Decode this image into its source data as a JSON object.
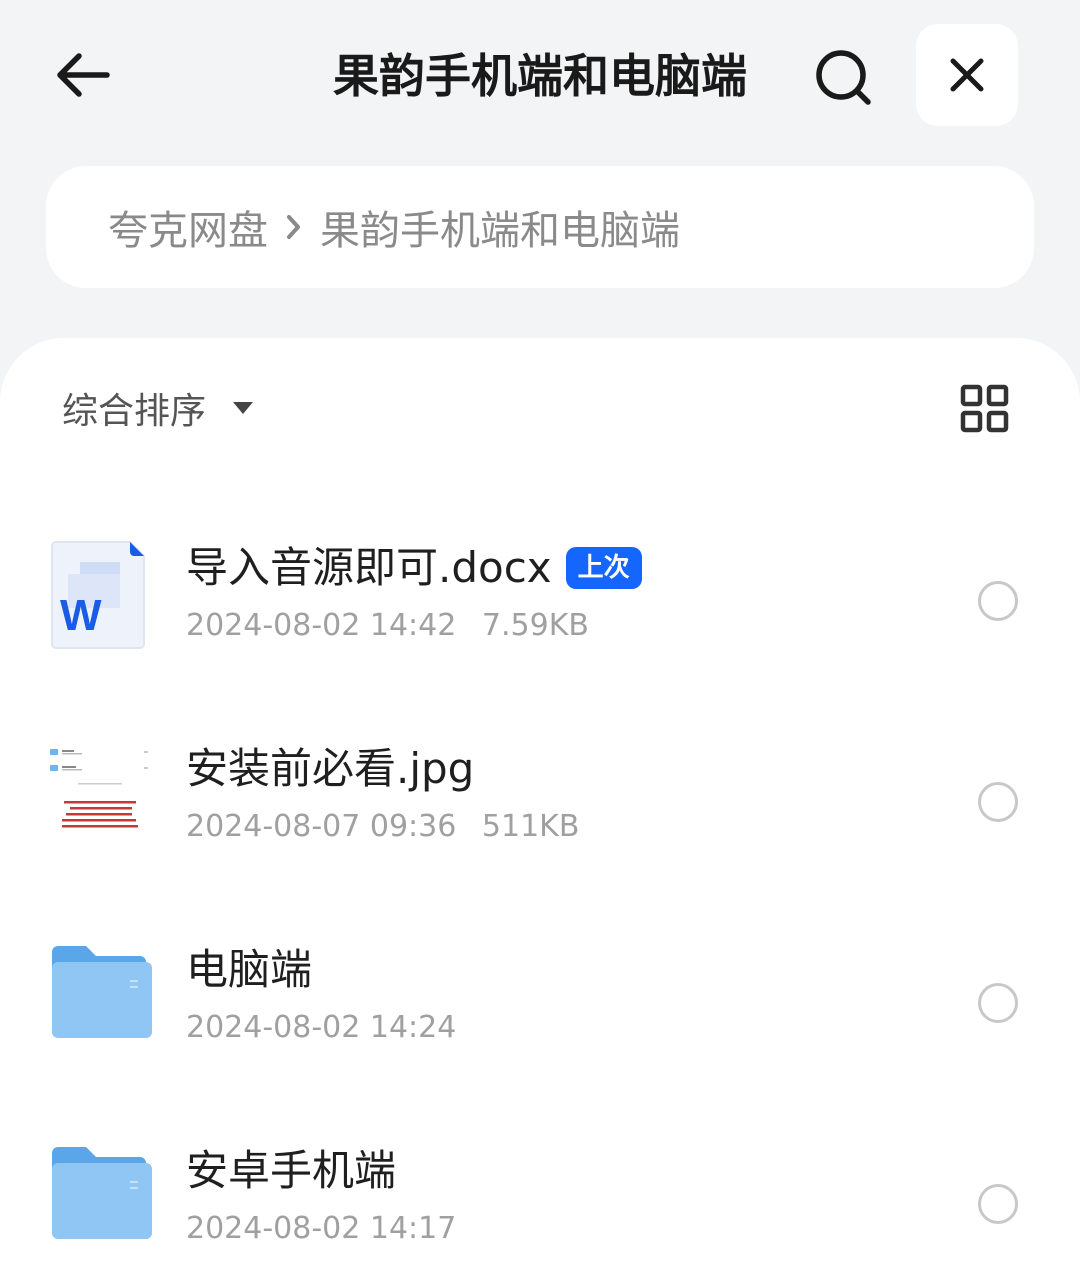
{
  "header": {
    "title": "果韵手机端和电脑端"
  },
  "breadcrumb": {
    "root": "夸克网盘",
    "current": "果韵手机端和电脑端"
  },
  "toolbar": {
    "sort_label": "综合排序"
  },
  "files": [
    {
      "name": "导入音源即可.docx",
      "badge": "上次",
      "date": "2024-08-02 14:42",
      "size": "7.59KB",
      "type": "docx",
      "icon_letter": "W"
    },
    {
      "name": "安装前必看.jpg",
      "date": "2024-08-07 09:36",
      "size": "511KB",
      "type": "image"
    },
    {
      "name": "电脑端",
      "date": "2024-08-02 14:24",
      "type": "folder"
    },
    {
      "name": "安卓手机端",
      "date": "2024-08-02 14:17",
      "type": "folder"
    }
  ],
  "colors": {
    "accent": "#1565ff",
    "folder": "#6fb5f0",
    "background": "#f3f4f6"
  },
  "icons": {
    "back": "arrow-left-icon",
    "search": "search-icon",
    "close": "close-icon",
    "breadcrumb_sep": "chevron-right-icon",
    "sort_caret": "caret-down-icon",
    "view_toggle": "grid-view-icon"
  }
}
